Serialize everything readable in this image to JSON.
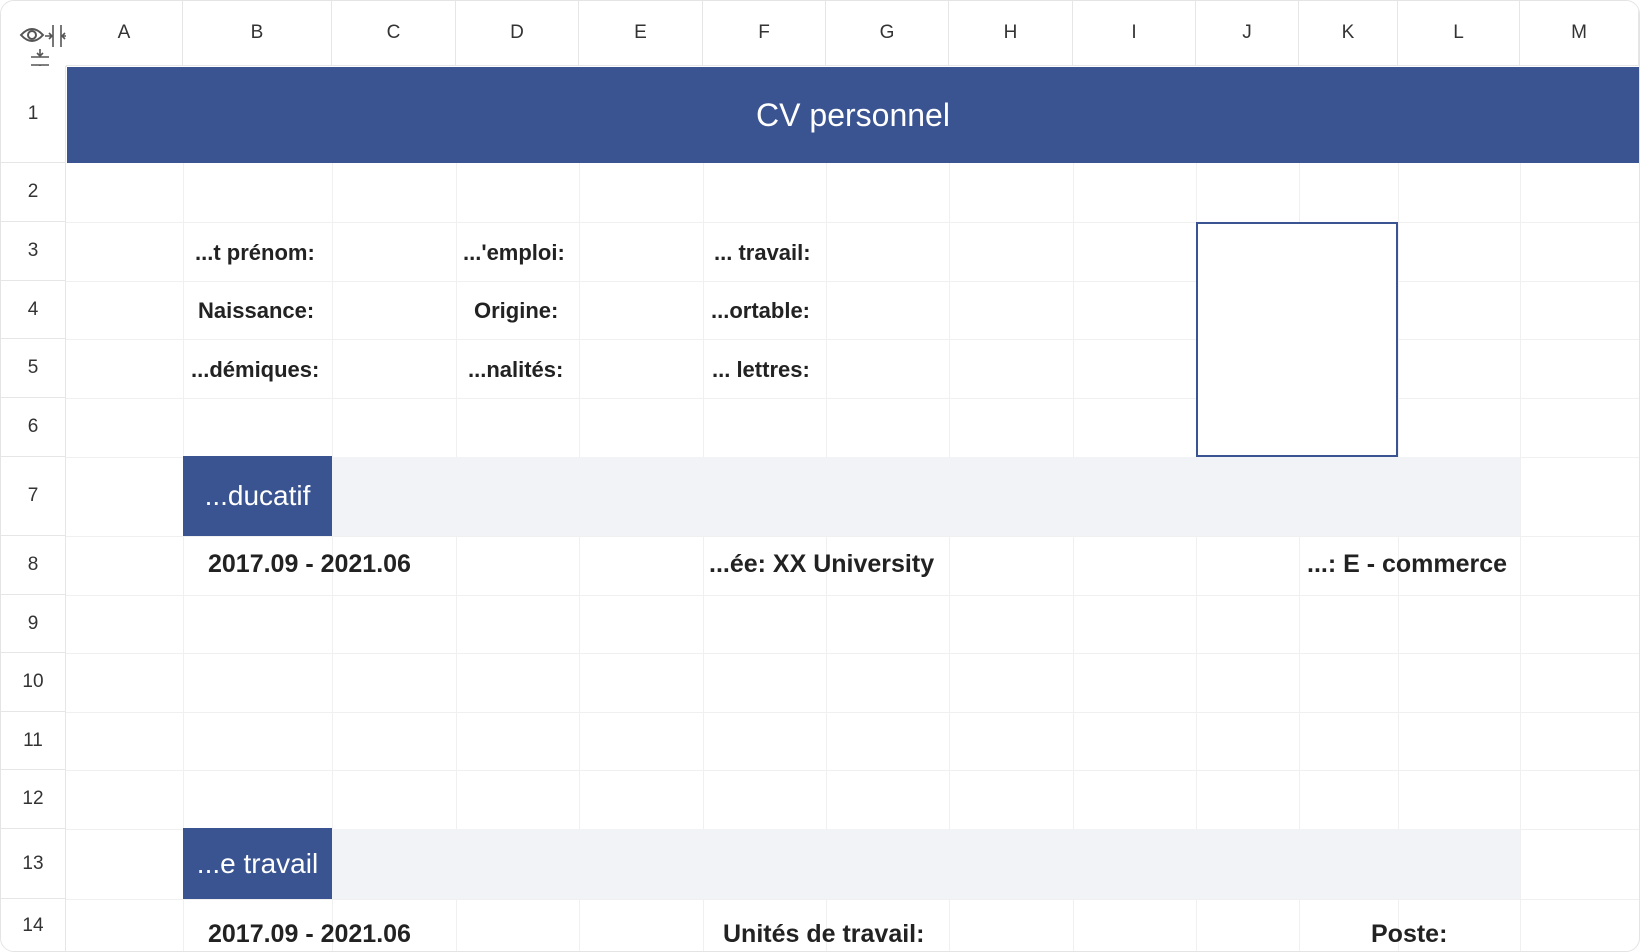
{
  "columns": [
    "A",
    "B",
    "C",
    "D",
    "E",
    "F",
    "G",
    "H",
    "I",
    "J",
    "K",
    "L",
    "M"
  ],
  "rows": [
    "1",
    "2",
    "3",
    "4",
    "5",
    "6",
    "7",
    "8",
    "9",
    "10",
    "11",
    "12",
    "13",
    "14"
  ],
  "corner": {
    "icons": [
      "eye-icon",
      "collapse-columns-icon",
      "collapse-rows-icon"
    ]
  },
  "sheet": {
    "title": "CV personnel",
    "labels": {
      "r3_b": "...t prénom:",
      "r3_d": "...'emploi:",
      "r3_f": "... travail:",
      "r4_b": "Naissance:",
      "r4_d": "Origine:",
      "r4_f": "...ortable:",
      "r5_b": "...démiques:",
      "r5_d": "...nalités:",
      "r5_f": "... lettres:"
    },
    "education": {
      "tag": "...ducatif",
      "period": "2017.09 - 2021.06",
      "school": "...ée: XX University",
      "major": "...: E - commerce"
    },
    "work": {
      "tag": "...e travail",
      "period": "2017.09 - 2021.06",
      "company_label": "Unités de travail:",
      "position_label": "Poste:"
    }
  },
  "colors": {
    "accent": "#3a5491",
    "section_fill": "#f2f3f6"
  }
}
